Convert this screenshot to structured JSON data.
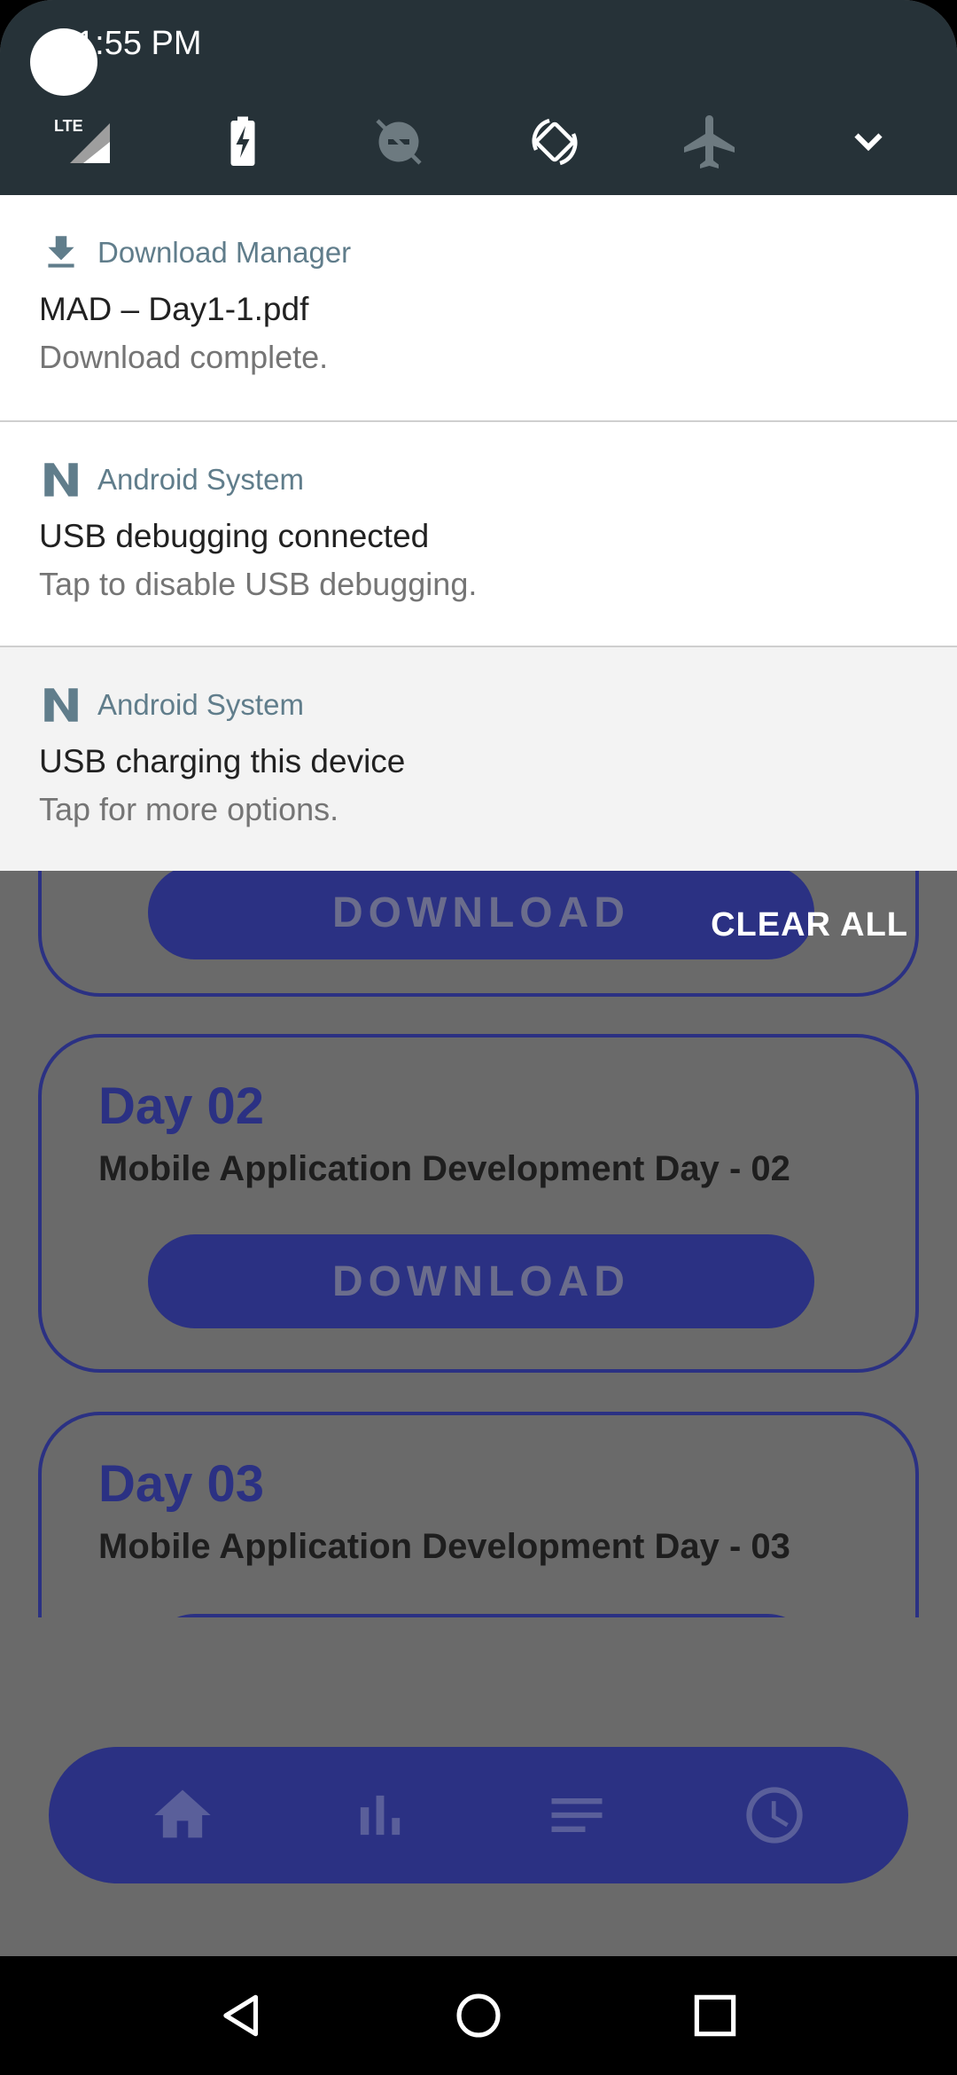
{
  "status_bar": {
    "time": "1:55 PM",
    "network_label": "LTE"
  },
  "quick_settings": [
    {
      "name": "signal-lte",
      "active": true
    },
    {
      "name": "battery-charging",
      "active": true
    },
    {
      "name": "do-not-disturb",
      "active": false
    },
    {
      "name": "auto-rotate",
      "active": true
    },
    {
      "name": "airplane-mode",
      "active": false
    },
    {
      "name": "expand",
      "active": true
    }
  ],
  "notifications": [
    {
      "app": "Download Manager",
      "icon": "download-icon",
      "title": "MAD – Day1-1.pdf",
      "text": "Download complete."
    },
    {
      "app": "Android System",
      "icon": "android-system-icon",
      "title": "USB debugging connected",
      "text": "Tap to disable USB debugging."
    },
    {
      "app": "Android System",
      "icon": "android-system-icon",
      "title": "USB charging this device",
      "text": "Tap for more options."
    }
  ],
  "clear_all_label": "CLEAR ALL",
  "app": {
    "download_label": "DOWNLOAD",
    "cards": [
      {
        "day": "",
        "subtitle": ""
      },
      {
        "day": "Day 02",
        "subtitle": "Mobile Application Development Day - 02"
      },
      {
        "day": "Day 03",
        "subtitle": "Mobile Application Development Day - 03"
      }
    ],
    "bottom_nav": [
      "home-icon",
      "stats-icon",
      "list-icon",
      "history-icon"
    ]
  },
  "colors": {
    "accent": "#2b3183",
    "shade": "#263238",
    "scrim": "#6a6a6a"
  }
}
